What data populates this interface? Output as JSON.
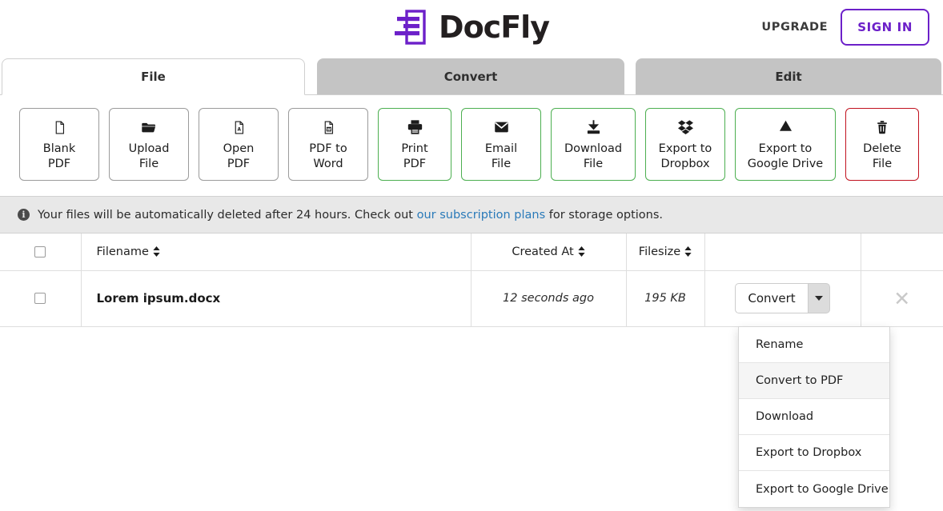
{
  "header": {
    "brand": "DocFly",
    "logo_color": "#6c20c9",
    "upgrade_label": "UPGRADE",
    "signin_label": "SIGN IN"
  },
  "tabs": [
    {
      "label": "File",
      "active": true
    },
    {
      "label": "Convert",
      "active": false
    },
    {
      "label": "Edit",
      "active": false
    }
  ],
  "toolbar": {
    "buttons": [
      {
        "label": "Blank\nPDF",
        "icon": "blank-file-icon",
        "style": "default",
        "width_class": "w-blank"
      },
      {
        "label": "Upload\nFile",
        "icon": "open-folder-icon",
        "style": "default",
        "width_class": "w-upload"
      },
      {
        "label": "Open\nPDF",
        "icon": "pdf-file-icon",
        "style": "default",
        "width_class": "w-open"
      },
      {
        "label": "PDF to\nWord",
        "icon": "word-file-icon",
        "style": "default",
        "width_class": "w-word"
      },
      {
        "label": "Print\nPDF",
        "icon": "printer-icon",
        "style": "green",
        "width_class": "w-print"
      },
      {
        "label": "Email\nFile",
        "icon": "envelope-icon",
        "style": "green",
        "width_class": "w-email"
      },
      {
        "label": "Download\nFile",
        "icon": "download-icon",
        "style": "green",
        "width_class": "w-down"
      },
      {
        "label": "Export to\nDropbox",
        "icon": "dropbox-icon",
        "style": "green",
        "width_class": "w-drop"
      },
      {
        "label": "Export to\nGoogle Drive",
        "icon": "google-drive-icon",
        "style": "green",
        "width_class": "w-gdrive"
      },
      {
        "label": "Delete\nFile",
        "icon": "trash-icon",
        "style": "red",
        "width_class": "w-del"
      }
    ],
    "green_color": "#4caf50",
    "red_color": "#c1121f"
  },
  "notice": {
    "icon": "info-icon",
    "text_before": "Your files will be automatically deleted after 24 hours. Check out ",
    "link_text": "our subscription plans",
    "text_after": " for storage options.",
    "link_color": "#2a7ab9"
  },
  "table": {
    "columns": [
      {
        "label": "",
        "sortable": false
      },
      {
        "label": "Filename",
        "sortable": true
      },
      {
        "label": "Created At",
        "sortable": true
      },
      {
        "label": "Filesize",
        "sortable": true
      },
      {
        "label": "",
        "sortable": false
      },
      {
        "label": "",
        "sortable": false
      }
    ],
    "rows": [
      {
        "filename": "Lorem ipsum.docx",
        "created_at": "12 seconds ago",
        "filesize": "195 KB",
        "action_label": "Convert",
        "checked": false
      }
    ]
  },
  "dropdown": {
    "open": true,
    "items": [
      {
        "label": "Rename",
        "hovered": false
      },
      {
        "label": "Convert to PDF",
        "hovered": true
      },
      {
        "label": "Download",
        "hovered": false
      },
      {
        "label": "Export to Dropbox",
        "hovered": false
      },
      {
        "label": "Export to Google Drive",
        "hovered": false
      }
    ]
  }
}
